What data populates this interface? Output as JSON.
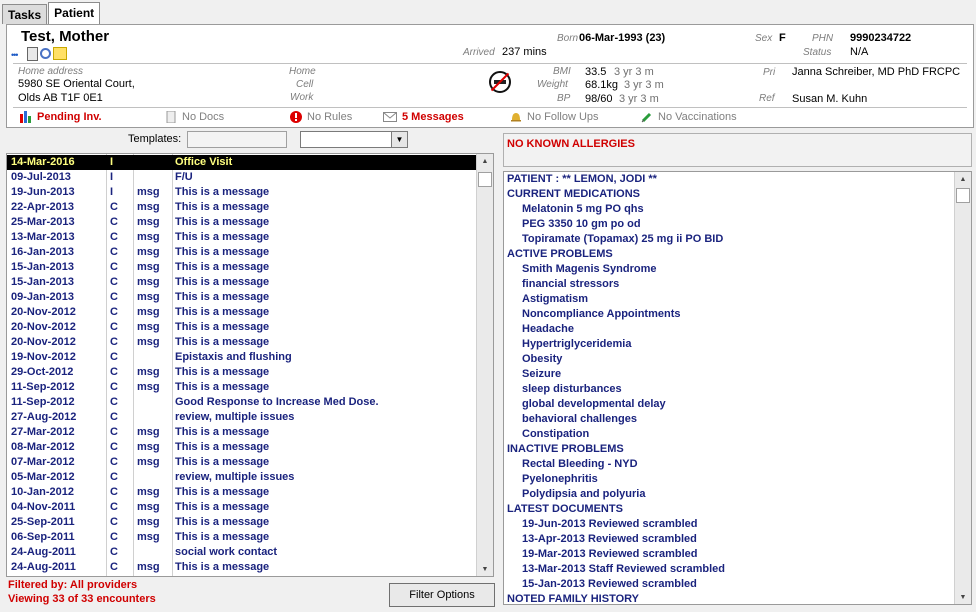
{
  "tabs": [
    "Tasks",
    "Patient"
  ],
  "patient": {
    "name": "Test, Mother",
    "born_label": "Born",
    "born_value": "06-Mar-1993 (23)",
    "arrived_label": "Arrived",
    "arrived_value": "237 mins",
    "sex_label": "Sex",
    "sex_value": "F",
    "phn_label": "PHN",
    "phn_value": "9990234722",
    "status_label": "Status",
    "status_value": "N/A",
    "home_address_label": "Home address",
    "address_line1": "5980 SE Oriental Court,",
    "address_line2": "Olds AB  T1F 0E1",
    "phone_home_label": "Home",
    "phone_cell_label": "Cell",
    "phone_work_label": "Work",
    "bmi_label": "BMI",
    "bmi_value": "33.5",
    "bmi_age": "3 yr 3 m",
    "weight_label": "Weight",
    "weight_value": "68.1kg",
    "weight_age": "3 yr 3 m",
    "bp_label": "BP",
    "bp_value": "98/60",
    "bp_age": "3 yr 3 m",
    "pri_label": "Pri",
    "pri_value": "Janna Schreiber, MD PhD FRCPC",
    "ref_label": "Ref",
    "ref_value": "Susan M. Kuhn"
  },
  "statusbar": {
    "pending": "Pending Inv.",
    "docs": "No Docs",
    "rules": "No Rules",
    "messages": "5 Messages",
    "followups": "No Follow Ups",
    "vaccinations": "No Vaccinations"
  },
  "templates": {
    "label": "Templates:"
  },
  "encounters": [
    {
      "date": "14-Mar-2016",
      "type": "I",
      "cat": "",
      "desc": "Office Visit"
    },
    {
      "date": "09-Jul-2013",
      "type": "I",
      "cat": "",
      "desc": "F/U"
    },
    {
      "date": "19-Jun-2013",
      "type": "I",
      "cat": "msg",
      "desc": "This is a message"
    },
    {
      "date": "22-Apr-2013",
      "type": "C",
      "cat": "msg",
      "desc": "This is a message"
    },
    {
      "date": "25-Mar-2013",
      "type": "C",
      "cat": "msg",
      "desc": "This is a message"
    },
    {
      "date": "13-Mar-2013",
      "type": "C",
      "cat": "msg",
      "desc": "This is a message"
    },
    {
      "date": "16-Jan-2013",
      "type": "C",
      "cat": "msg",
      "desc": "This is a message"
    },
    {
      "date": "15-Jan-2013",
      "type": "C",
      "cat": "msg",
      "desc": "This is a message"
    },
    {
      "date": "15-Jan-2013",
      "type": "C",
      "cat": "msg",
      "desc": "This is a message"
    },
    {
      "date": "09-Jan-2013",
      "type": "C",
      "cat": "msg",
      "desc": "This is a message"
    },
    {
      "date": "20-Nov-2012",
      "type": "C",
      "cat": "msg",
      "desc": "This is a message"
    },
    {
      "date": "20-Nov-2012",
      "type": "C",
      "cat": "msg",
      "desc": "This is a message"
    },
    {
      "date": "20-Nov-2012",
      "type": "C",
      "cat": "msg",
      "desc": "This is a message"
    },
    {
      "date": "19-Nov-2012",
      "type": "C",
      "cat": "",
      "desc": "Epistaxis and flushing"
    },
    {
      "date": "29-Oct-2012",
      "type": "C",
      "cat": "msg",
      "desc": "This is a message"
    },
    {
      "date": "11-Sep-2012",
      "type": "C",
      "cat": "msg",
      "desc": "This is a message"
    },
    {
      "date": "11-Sep-2012",
      "type": "C",
      "cat": "",
      "desc": "Good Response to Increase Med Dose."
    },
    {
      "date": "27-Aug-2012",
      "type": "C",
      "cat": "",
      "desc": "review, multiple issues"
    },
    {
      "date": "27-Mar-2012",
      "type": "C",
      "cat": "msg",
      "desc": "This is a message"
    },
    {
      "date": "08-Mar-2012",
      "type": "C",
      "cat": "msg",
      "desc": "This is a message"
    },
    {
      "date": "07-Mar-2012",
      "type": "C",
      "cat": "msg",
      "desc": "This is a message"
    },
    {
      "date": "05-Mar-2012",
      "type": "C",
      "cat": "",
      "desc": "review, multiple issues"
    },
    {
      "date": "10-Jan-2012",
      "type": "C",
      "cat": "msg",
      "desc": "This is a message"
    },
    {
      "date": "04-Nov-2011",
      "type": "C",
      "cat": "msg",
      "desc": "This is a message"
    },
    {
      "date": "25-Sep-2011",
      "type": "C",
      "cat": "msg",
      "desc": "This is a message"
    },
    {
      "date": "06-Sep-2011",
      "type": "C",
      "cat": "msg",
      "desc": "This is a message"
    },
    {
      "date": "24-Aug-2011",
      "type": "C",
      "cat": "",
      "desc": "social work contact"
    },
    {
      "date": "24-Aug-2011",
      "type": "C",
      "cat": "msg",
      "desc": "This is a message"
    }
  ],
  "filter": {
    "filtered_by": "Filtered by: All providers",
    "viewing": "Viewing 33 of 33 encounters",
    "button": "Filter Options"
  },
  "allergies": "NO KNOWN ALLERGIES",
  "summary": [
    {
      "kind": "hdr",
      "text": "PATIENT : ** LEMON, JODI **"
    },
    {
      "kind": "hdr",
      "text": "CURRENT MEDICATIONS"
    },
    {
      "kind": "item",
      "text": "Melatonin 5 mg    PO  qhs"
    },
    {
      "kind": "item",
      "text": "PEG 3350 10 gm po od"
    },
    {
      "kind": "item",
      "text": "Topiramate (Topamax) 25 mg   ii PO  BID"
    },
    {
      "kind": "hdr",
      "text": "ACTIVE PROBLEMS"
    },
    {
      "kind": "item",
      "text": "Smith Magenis Syndrome"
    },
    {
      "kind": "item",
      "text": "financial stressors"
    },
    {
      "kind": "item",
      "text": "Astigmatism"
    },
    {
      "kind": "item",
      "text": "Noncompliance Appointments"
    },
    {
      "kind": "item",
      "text": "Headache"
    },
    {
      "kind": "item",
      "text": "Hypertriglyceridemia"
    },
    {
      "kind": "item",
      "text": "Obesity"
    },
    {
      "kind": "item",
      "text": "Seizure"
    },
    {
      "kind": "item",
      "text": "sleep disturbances"
    },
    {
      "kind": "item",
      "text": "global developmental  delay"
    },
    {
      "kind": "item",
      "text": "behavioral challenges"
    },
    {
      "kind": "item",
      "text": "Constipation"
    },
    {
      "kind": "hdr",
      "text": "INACTIVE PROBLEMS"
    },
    {
      "kind": "item",
      "text": "Rectal Bleeding - NYD"
    },
    {
      "kind": "item",
      "text": "Pyelonephritis"
    },
    {
      "kind": "item",
      "text": "Polydipsia and polyuria"
    },
    {
      "kind": "hdr",
      "text": "LATEST DOCUMENTS"
    },
    {
      "kind": "item",
      "text": "19-Jun-2013 Reviewed scrambled"
    },
    {
      "kind": "item",
      "text": "13-Apr-2013 Reviewed scrambled"
    },
    {
      "kind": "item",
      "text": "19-Mar-2013 Reviewed scrambled"
    },
    {
      "kind": "item",
      "text": "13-Mar-2013 Staff Reviewed scrambled"
    },
    {
      "kind": "item",
      "text": "15-Jan-2013 Reviewed scrambled"
    },
    {
      "kind": "hdr",
      "text": "NOTED FAMILY HISTORY"
    }
  ]
}
